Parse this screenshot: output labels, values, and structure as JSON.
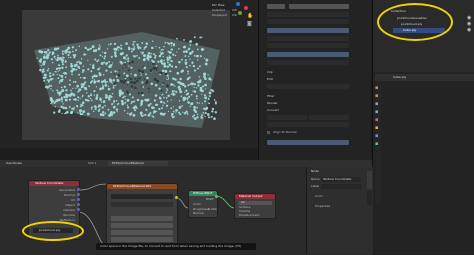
{
  "viewport": {
    "stats": [
      {
        "label": "PLY Files",
        "value": ""
      },
      {
        "label": "Selected",
        "value": "0/6"
      },
      {
        "label": "Displayed",
        "value": "0/6"
      }
    ],
    "axes": {
      "x": "X",
      "y": "Y",
      "z": "Z"
    }
  },
  "properties": {
    "sections": [
      "Clip",
      "Edit",
      "Filter",
      "Render",
      "Convert"
    ],
    "fields": [
      "Align To Normal"
    ]
  },
  "outliner": {
    "rows": [
      "Collection",
      "pointcloudvisualizer",
      "pointcloud.ply",
      "Cube.ply"
    ]
  },
  "props_panel": {
    "object_name": "Cube.ply"
  },
  "node_editor": {
    "header_tabs": [
      "Use Nodes",
      "Slot 1",
      "PCPointcloudMaterial"
    ],
    "nodes": {
      "texcoord": {
        "title": "Texture Coordinate",
        "outputs": [
          "Generated",
          "Normal",
          "UV",
          "Object",
          "Camera",
          "Window",
          "Reflection"
        ],
        "object_field": "pointcloud.ply"
      },
      "attr": {
        "title": "PCPointcloudMaterial.001"
      },
      "bsdf": {
        "title": "Diffuse BSDF",
        "rows": [
          "BSDF",
          "Color",
          "Roughness",
          "Normal"
        ],
        "roughness": "0.000"
      },
      "output": {
        "title": "Material Output",
        "rows": [
          "All",
          "Surface",
          "Volume",
          "Displacement"
        ]
      }
    },
    "npanel": {
      "section": "Node",
      "name_label": "Name",
      "name_value": "Texture Coordinate",
      "label_label": "Label",
      "color_label": "Color",
      "properties_label": "Properties"
    },
    "status": "Color space in the Image file, to convert to and from when saving and loading the image. (F2)"
  },
  "colors": {
    "pointcloud": "#9fd6d6",
    "annotation": "#f0d400",
    "node_texcoord": "#8e2e3c",
    "node_shader": "#2e8a5e",
    "node_output": "#8e2e3c",
    "node_attr": "#8a4a24"
  }
}
